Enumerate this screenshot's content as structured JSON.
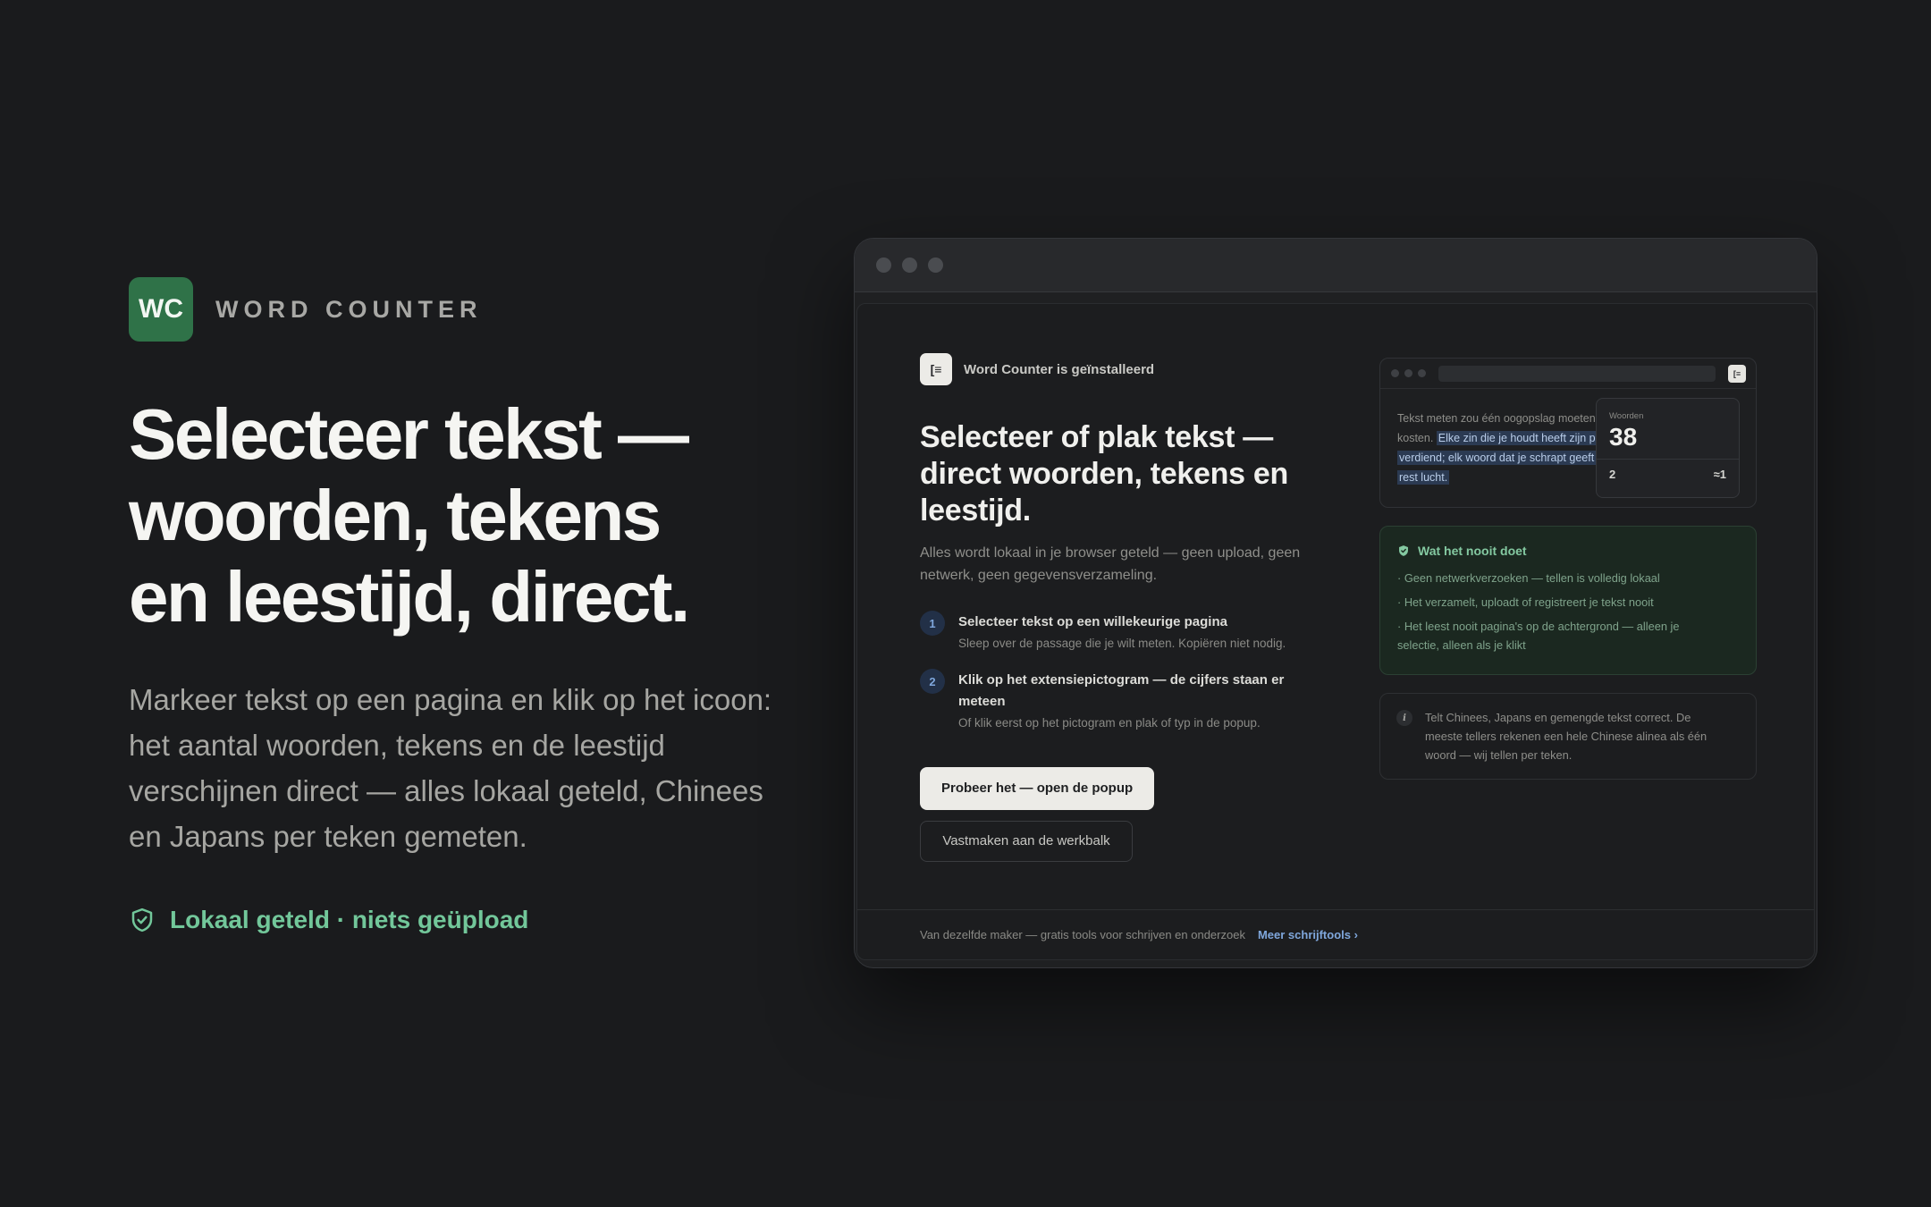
{
  "brand": {
    "logo_text": "WC",
    "name": "WORD COUNTER"
  },
  "hero": {
    "headline_lines": [
      "Selecteer tekst —",
      "woorden, tekens",
      "en leestijd, direct."
    ],
    "lead_lines": [
      "Markeer tekst op een pagina en klik op het icoon:",
      "het aantal woorden, tekens en de leestijd",
      "verschijnen direct — alles lokaal geteld, Chinees",
      "en Japans per teken gemeten."
    ],
    "local_badge": "Lokaal geteld · niets geüpload",
    "local_badge_icon": "shield-check-icon"
  },
  "browser": {
    "installed_label": "Word Counter is geïnstalleerd",
    "title_lines": [
      "Selecteer of plak tekst —",
      "direct woorden, tekens en",
      "leestijd."
    ],
    "subtitle_lines": [
      "Alles wordt lokaal in je browser geteld — geen upload, geen",
      "netwerk, geen gegevensverzameling."
    ],
    "steps": [
      {
        "num": "1",
        "title_lines": [
          "Selecteer tekst op een willekeurige pagina"
        ],
        "desc": "Sleep over de passage die je wilt meten. Kopiëren niet nodig."
      },
      {
        "num": "2",
        "title_lines": [
          "Klik op het extensiepictogram — de cijfers staan er",
          "meteen"
        ],
        "desc": "Of klik eerst op het pictogram en plak of typ in de popup."
      }
    ],
    "primary_button": "Probeer het — open de popup",
    "secondary_button": "Vastmaken aan de werkbalk",
    "preview": {
      "text_line1": "Tekst meten zou één oogopslag moeten",
      "text_line2_plain": "kosten.",
      "text_line2_highlight": "Elke zin die je houdt heeft zijn plek",
      "text_line3_highlight": "verdiend; elk woord dat je schrapt geeft de",
      "text_line4_highlight": "rest lucht.",
      "popup_label": "Woorden",
      "popup_value": "38",
      "popup_left": "2",
      "popup_right": "≈1"
    },
    "never": {
      "title": "Wat het nooit doet",
      "items": [
        [
          "· Geen netwerkverzoeken — tellen is volledig lokaal"
        ],
        [
          "· Het verzamelt, uploadt of registreert je tekst nooit"
        ],
        [
          "· Het leest nooit pagina's op de achtergrond — alleen je",
          "selectie, alleen als je klikt"
        ]
      ]
    },
    "info": {
      "icon": "i",
      "lines": [
        "Telt Chinees, Japans en gemengde tekst correct. De",
        "meeste tellers rekenen een hele Chinese alinea als één",
        "woord — wij tellen per teken."
      ]
    },
    "footer": {
      "text": "Van dezelfde maker — gratis tools voor schrijven en onderzoek",
      "link": "Meer schrijftools ›"
    }
  },
  "colors": {
    "background": "#1a1b1d",
    "logo_green": "#2f7248",
    "accent_green": "#72c79a",
    "accent_blue": "#7fa7dc"
  }
}
